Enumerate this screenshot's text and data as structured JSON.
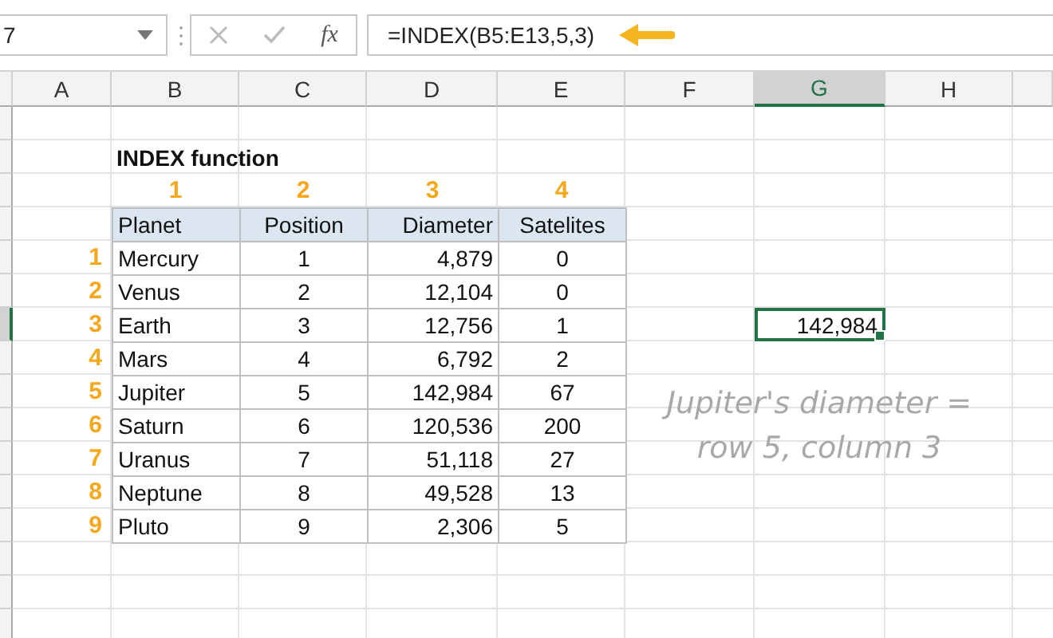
{
  "name_box": {
    "value": "7"
  },
  "formula_bar": {
    "fx_label": "fx",
    "formula": "=INDEX(B5:E13,5,3)"
  },
  "columns": [
    {
      "label": "A",
      "selected": false
    },
    {
      "label": "B",
      "selected": false
    },
    {
      "label": "C",
      "selected": false
    },
    {
      "label": "D",
      "selected": false
    },
    {
      "label": "E",
      "selected": false
    },
    {
      "label": "F",
      "selected": false
    },
    {
      "label": "G",
      "selected": true
    },
    {
      "label": "H",
      "selected": false
    }
  ],
  "row_headers": [
    {
      "selected": false
    },
    {
      "selected": false
    },
    {
      "selected": false
    },
    {
      "selected": false
    },
    {
      "selected": false
    },
    {
      "selected": false
    },
    {
      "selected": true
    },
    {
      "selected": false
    },
    {
      "selected": false
    },
    {
      "selected": false
    },
    {
      "selected": false
    },
    {
      "selected": false
    },
    {
      "selected": false
    },
    {
      "selected": false
    },
    {
      "selected": false
    },
    {
      "selected": false
    }
  ],
  "title": "INDEX function",
  "column_numbers": [
    "1",
    "2",
    "3",
    "4"
  ],
  "table": {
    "columns": [
      "Planet",
      "Position",
      "Diameter",
      "Satelites"
    ],
    "rows": [
      {
        "row_number": "1",
        "cells": [
          "Mercury",
          "1",
          "4,879",
          "0"
        ]
      },
      {
        "row_number": "2",
        "cells": [
          "Venus",
          "2",
          "12,104",
          "0"
        ]
      },
      {
        "row_number": "3",
        "cells": [
          "Earth",
          "3",
          "12,756",
          "1"
        ]
      },
      {
        "row_number": "4",
        "cells": [
          "Mars",
          "4",
          "6,792",
          "2"
        ]
      },
      {
        "row_number": "5",
        "cells": [
          "Jupiter",
          "5",
          "142,984",
          "67"
        ]
      },
      {
        "row_number": "6",
        "cells": [
          "Saturn",
          "6",
          "120,536",
          "200"
        ]
      },
      {
        "row_number": "7",
        "cells": [
          "Uranus",
          "7",
          "51,118",
          "27"
        ]
      },
      {
        "row_number": "8",
        "cells": [
          "Neptune",
          "8",
          "49,528",
          "13"
        ]
      },
      {
        "row_number": "9",
        "cells": [
          "Pluto",
          "9",
          "2,306",
          "5"
        ]
      }
    ]
  },
  "active_cell": {
    "value": "142,984"
  },
  "note": [
    "Jupiter's diameter =",
    "row 5, column 3"
  ]
}
